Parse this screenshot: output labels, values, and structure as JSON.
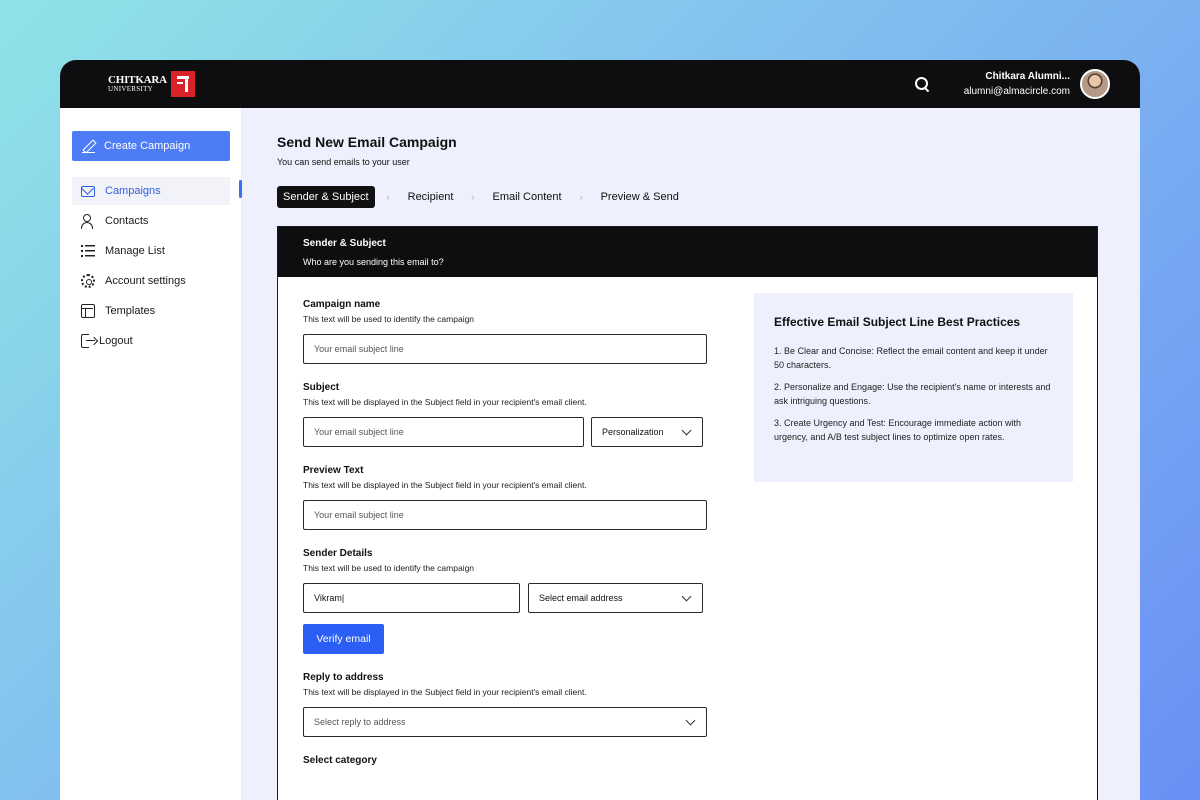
{
  "brand": {
    "line1": "CHITKARA",
    "line2": "UNIVERSITY"
  },
  "user": {
    "name": "Chitkara Alumni...",
    "email": "alumni@almacircle.com"
  },
  "sidebar": {
    "create_label": "Create Campaign",
    "items": [
      {
        "label": "Campaigns",
        "icon": "mail-icon"
      },
      {
        "label": "Contacts",
        "icon": "contacts-icon"
      },
      {
        "label": "Manage List",
        "icon": "list-icon"
      },
      {
        "label": "Account settings",
        "icon": "gear-icon"
      },
      {
        "label": "Templates",
        "icon": "templates-icon"
      },
      {
        "label": "Logout",
        "icon": "logout-icon"
      }
    ]
  },
  "page": {
    "title": "Send New Email Campaign",
    "subtitle": "You can send emails to your user"
  },
  "steps": [
    "Sender & Subject",
    "Recipient",
    "Email Content",
    "Preview & Send"
  ],
  "card": {
    "title": "Sender & Subject",
    "subtitle": "Who are you sending this email to?"
  },
  "form": {
    "campaign": {
      "label": "Campaign name",
      "help": "This text will be used to identify the campaign",
      "placeholder": "Your email subject line"
    },
    "subject": {
      "label": "Subject",
      "help": "This text will be displayed in the Subject field in your recipient's email client.",
      "placeholder": "Your email subject line",
      "personalization": "Personalization"
    },
    "preview": {
      "label": "Preview Text",
      "help": "This text will be displayed in the Subject field in your recipient's email client.",
      "placeholder": "Your email subject line"
    },
    "sender": {
      "label": "Sender Details",
      "help": "This text will be used to identify the campaign",
      "name_value": "Vikram|",
      "email_select": "Select email address",
      "verify_label": "Verify email"
    },
    "reply": {
      "label": "Reply to address",
      "help": "This text will be displayed in the Subject field in your recipient's email client.",
      "select": "Select reply to address"
    },
    "category": {
      "label": "Select category"
    }
  },
  "tips": {
    "title": "Effective Email Subject Line Best Practices",
    "items": [
      "1.  Be Clear and Concise: Reflect the email content and keep it under 50 characters.",
      "2. Personalize and Engage: Use the recipient's name or interests and ask intriguing questions.",
      "3. Create Urgency and Test: Encourage immediate action with urgency, and A/B test subject lines to optimize open rates."
    ]
  }
}
